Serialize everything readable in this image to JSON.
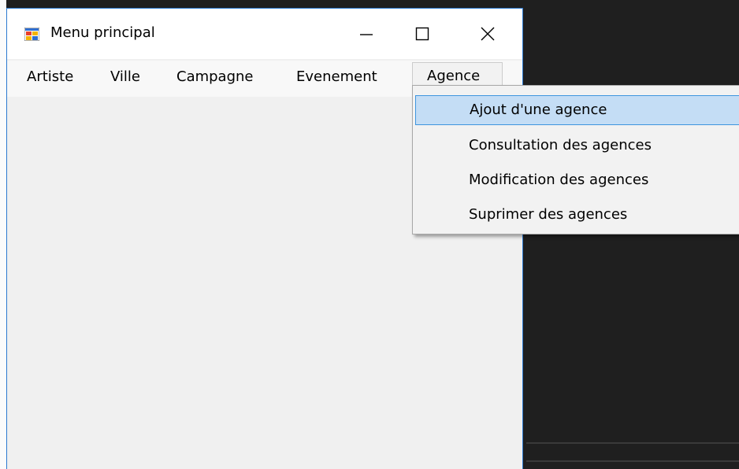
{
  "window": {
    "title": "Menu principal",
    "icon": "winforms-app-icon",
    "controls": {
      "minimize": "minimize-icon",
      "maximize": "maximize-icon",
      "close": "close-icon"
    }
  },
  "menubar": {
    "items": [
      {
        "label": "Artiste"
      },
      {
        "label": "Ville"
      },
      {
        "label": "Campagne"
      },
      {
        "label": "Evenement"
      },
      {
        "label": "Agence",
        "open": true
      }
    ]
  },
  "dropdown": {
    "items": [
      {
        "label": "Ajout d'une agence",
        "highlighted": true
      },
      {
        "label": "Consultation des agences"
      },
      {
        "label": "Modification des agences"
      },
      {
        "label": "Suprimer des agences"
      }
    ]
  },
  "colors": {
    "highlight_fill": "#c4ddf5",
    "highlight_border": "#3e95de",
    "window_border": "#2b79d0",
    "background_dark": "#1f1f1f"
  }
}
